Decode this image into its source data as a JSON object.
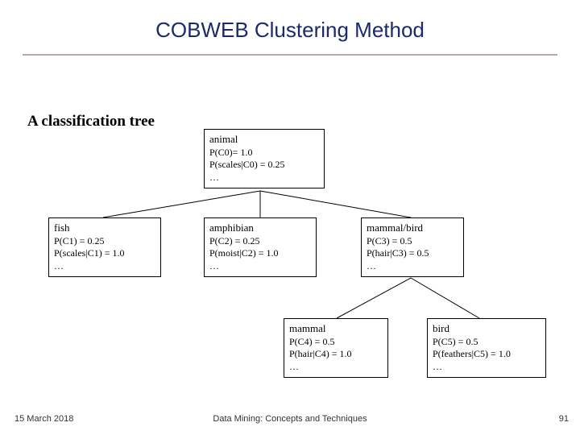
{
  "title": "COBWEB Clustering Method",
  "caption": "A classification tree",
  "nodes": {
    "root": {
      "label": "animal",
      "prob": "P(C0)= 1.0",
      "cond": "P(scales|C0) = 0.25",
      "dots": "…"
    },
    "fish": {
      "label": "fish",
      "prob": "P(C1) = 0.25",
      "cond": "P(scales|C1) = 1.0",
      "dots": "…"
    },
    "amphibian": {
      "label": "amphibian",
      "prob": "P(C2) = 0.25",
      "cond": "P(moist|C2) = 1.0",
      "dots": "…"
    },
    "mammalbird": {
      "label": "mammal/bird",
      "prob": "P(C3) = 0.5",
      "cond": "P(hair|C3) = 0.5",
      "dots": "…"
    },
    "mammal": {
      "label": "mammal",
      "prob": "P(C4) = 0.5",
      "cond": "P(hair|C4) = 1.0",
      "dots": "…"
    },
    "bird": {
      "label": "bird",
      "prob": "P(C5) = 0.5",
      "cond": "P(feathers|C5) = 1.0",
      "dots": "…"
    }
  },
  "footer": {
    "date": "15 March 2018",
    "center": "Data Mining: Concepts and Techniques",
    "page": "91"
  }
}
